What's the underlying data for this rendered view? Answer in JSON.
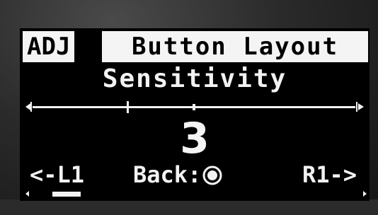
{
  "header": {
    "mode_badge": "ADJ",
    "title": "Button Layout"
  },
  "setting": {
    "name": "Sensitivity",
    "value": "3",
    "level": 3,
    "min": 1,
    "max": 5
  },
  "footer": {
    "left": "<-L1",
    "back": "Back:",
    "right": "R1->"
  },
  "icons": {
    "slider_left": "arrow-left-icon",
    "slider_right": "arrow-right-icon",
    "back_button": "circle-button-icon"
  },
  "scrollbar": {
    "position": 0.0
  },
  "colors": {
    "screen": "#000000",
    "text": "#f4f4f4",
    "bezel": "#2a2a2a"
  }
}
